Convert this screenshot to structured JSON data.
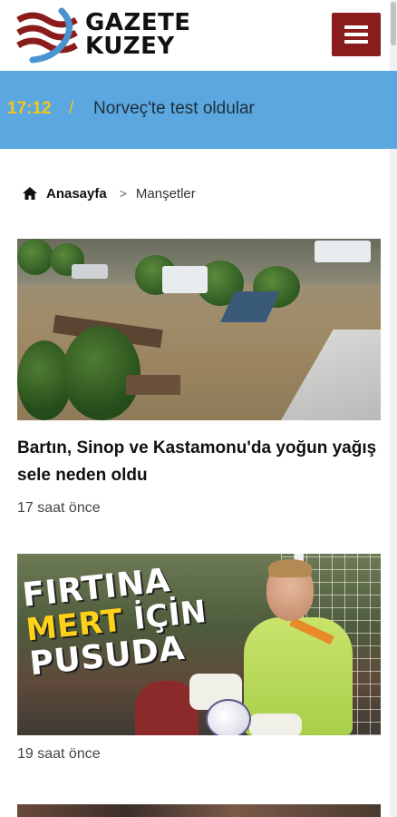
{
  "header": {
    "logo_line1": "GAZETE",
    "logo_line2": "KUZEY",
    "menu_icon": "hamburger-icon",
    "brand_color": "#8a1c1c"
  },
  "ticker": {
    "time": "17:12",
    "separator": "/",
    "text": "Norveç'te test oldular",
    "background": "#5aa8df",
    "accent": "#f5c518"
  },
  "breadcrumb": {
    "home_icon": "home-icon",
    "home": "Anasayfa",
    "separator": ">",
    "current": "Manşetler"
  },
  "articles": [
    {
      "title": "Bartın, Sinop ve Kastamonu'da yoğun yağış sele neden oldu",
      "time": "17 saat önce"
    },
    {
      "image_text": {
        "line1": "FIRTINA",
        "line2_highlight": "MERT",
        "line2_rest": "İÇİN",
        "line3": "PUSUDA"
      },
      "time": "19 saat önce"
    }
  ]
}
